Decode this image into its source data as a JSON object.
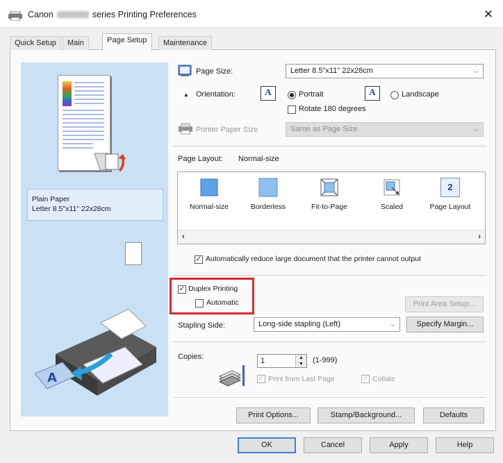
{
  "window": {
    "title_prefix": "Canon",
    "title_suffix": "series Printing Preferences",
    "close_glyph": "✕"
  },
  "tabs": [
    {
      "label": "Quick Setup"
    },
    {
      "label": "Main"
    },
    {
      "label": "Page Setup",
      "active": true
    },
    {
      "label": "Maintenance"
    }
  ],
  "preview": {
    "media_type": "Plain Paper",
    "paper_size": "Letter 8.5\"x11\" 22x28cm"
  },
  "page_size": {
    "label": "Page Size:",
    "value": "Letter 8.5\"x11\" 22x28cm"
  },
  "orientation": {
    "label": "Orientation:",
    "portrait": "Portrait",
    "landscape": "Landscape",
    "selected": "Portrait",
    "rotate_label": "Rotate 180 degrees",
    "rotate_checked": false
  },
  "printer_paper_size": {
    "label": "Printer Paper Size",
    "value": "Same as Page Size",
    "enabled": false
  },
  "page_layout": {
    "label": "Page Layout:",
    "value": "Normal-size",
    "items": [
      {
        "label": "Normal-size",
        "icon": "normal-size-icon"
      },
      {
        "label": "Borderless",
        "icon": "borderless-icon"
      },
      {
        "label": "Fit-to-Page",
        "icon": "fit-to-page-icon"
      },
      {
        "label": "Scaled",
        "icon": "scaled-icon"
      },
      {
        "label": "Page Layout",
        "icon": "page-layout-icon",
        "glyph": "2"
      }
    ]
  },
  "auto_reduce": {
    "label": "Automatically reduce large document that the printer cannot output",
    "checked": true
  },
  "duplex": {
    "label": "Duplex Printing",
    "checked": true,
    "automatic_label": "Automatic",
    "automatic_checked": false
  },
  "print_area_setup": {
    "label": "Print Area Setup...",
    "enabled": false
  },
  "stapling": {
    "label": "Stapling Side:",
    "value": "Long-side stapling (Left)"
  },
  "specify_margin": {
    "label": "Specify Margin..."
  },
  "copies": {
    "label": "Copies:",
    "value": "1",
    "range": "(1-999)",
    "print_from_last_label": "Print from Last Page",
    "print_from_last_checked": true,
    "collate_label": "Collate",
    "collate_checked": true
  },
  "footer_buttons": {
    "print_options": "Print Options...",
    "stamp_background": "Stamp/Background...",
    "defaults": "Defaults"
  },
  "dialog_buttons": {
    "ok": "OK",
    "cancel": "Cancel",
    "apply": "Apply",
    "help": "Help"
  },
  "colors": {
    "highlight": "#d22b2b",
    "panel_blue": "#c9e0f5",
    "focus_blue": "#3d7ed6"
  }
}
